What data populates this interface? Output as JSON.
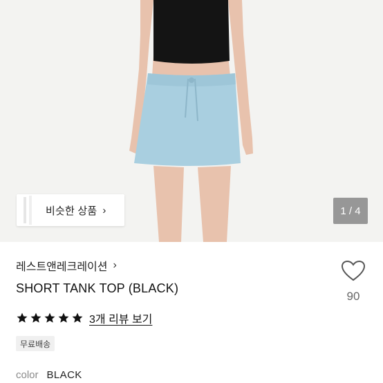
{
  "gallery": {
    "similar_label": "비슷한 상품",
    "similar_chevron": "›",
    "page_counter": "1 / 4"
  },
  "product": {
    "brand": "레스트앤레크레이션",
    "brand_chevron": "›",
    "title": "SHORT TANK TOP (BLACK)",
    "rating": 5,
    "review_link": "3개 리뷰 보기",
    "shipping_badge": "무료배송",
    "color_label": "color",
    "color_value": "BLACK"
  },
  "like": {
    "icon": "heart-icon",
    "count": "90"
  },
  "colors": {
    "star": "#111111",
    "hero_bg": "#f3f3f1",
    "skirt": "#a9cfe0",
    "top": "#141414",
    "skin": "#e8c2ad"
  }
}
